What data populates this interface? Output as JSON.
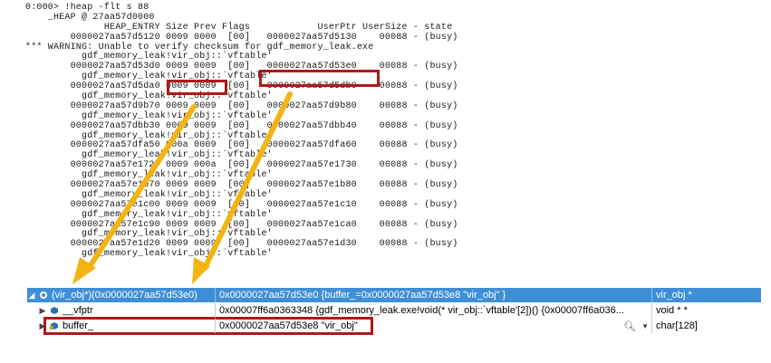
{
  "console": {
    "lines": [
      "0:000> !heap -flt s 88",
      "    _HEAP @ 27aa57d0000",
      "              HEAP_ENTRY Size Prev Flags            UserPtr UserSize - state",
      "        0000027aa57d5120 0009 0000  [00]   0000027aa57d5130    00088 - (busy)",
      "*** WARNING: Unable to verify checksum for gdf_memory_leak.exe",
      "          gdf_memory_leak!vir_obj::`vftable'",
      "        0000027aa57d53d0 0009 0009  [00]   0000027aa57d53e0    00088 - (busy)",
      "          gdf_memory_leak!vir_obj::`vftable'",
      "        0000027aa57d5da0 0009 0009  [00]   0000027aa57d5db0    00088 - (busy)",
      "          gdf_memory_leak!vir_obj::`vftable'",
      "        0000027aa57d9b70 0009 0009  [00]   0000027aa57d9b80    00088 - (busy)",
      "          gdf_memory_leak!vir_obj::`vftable'",
      "        0000027aa57dbb30 0009 0009  [00]   0000027aa57dbb40    00088 - (busy)",
      "          gdf_memory_leak!vir_obj::`vftable'",
      "        0000027aa57dfa50 000a 0009  [00]   0000027aa57dfa60    00088 - (busy)",
      "          gdf_memory_leak!vir_obj::`vftable'",
      "        0000027aa57e1720 0009 000a  [00]   0000027aa57e1730    00088 - (busy)",
      "          gdf_memory_leak!vir_obj::`vftable'",
      "        0000027aa57e1b70 0009 0009  [00]   0000027aa57e1b80    00088 - (busy)",
      "          gdf_memory_leak!vir_obj::`vftable'",
      "        0000027aa57e1c00 0009 0009  [00]   0000027aa57e1c10    00088 - (busy)",
      "          gdf_memory_leak!vir_obj::`vftable'",
      "        0000027aa57e1c90 0009 0009  [00]   0000027aa57e1ca0    00088 - (busy)",
      "          gdf_memory_leak!vir_obj::`vftable'",
      "        0000027aa57e1d20 0009 0009  [00]   0000027aa57e1d30    00088 - (busy)",
      "          gdf_memory_leak!vir_obj::`vftable'"
    ]
  },
  "watch": {
    "rows": [
      {
        "name": "(vir_obj*)(0x0000027aa57d53e0)",
        "value": "0x0000027aa57d53e0 {buffer_=0x0000027aa57d53e8 \"vir_obj\" }",
        "type": "vir_obj *",
        "expander": "◢",
        "icon": "object-icon"
      },
      {
        "name": "__vfptr",
        "value": "0x00007ff6a0363348 {gdf_memory_leak.exe!void(* vir_obj::`vftable'[2])() {0x00007ff6a036...",
        "type": "void * *",
        "expander": "▶",
        "icon": "field-icon"
      },
      {
        "name": "buffer_",
        "value": "0x0000027aa57d53e8 \"vir_obj\"",
        "type": "char[128]",
        "expander": "▶",
        "icon": "lock-field-icon"
      }
    ]
  },
  "colors": {
    "highlight_box": "#b01818",
    "arrow": "#f3b413",
    "selected_row": "#3f8fd6"
  }
}
